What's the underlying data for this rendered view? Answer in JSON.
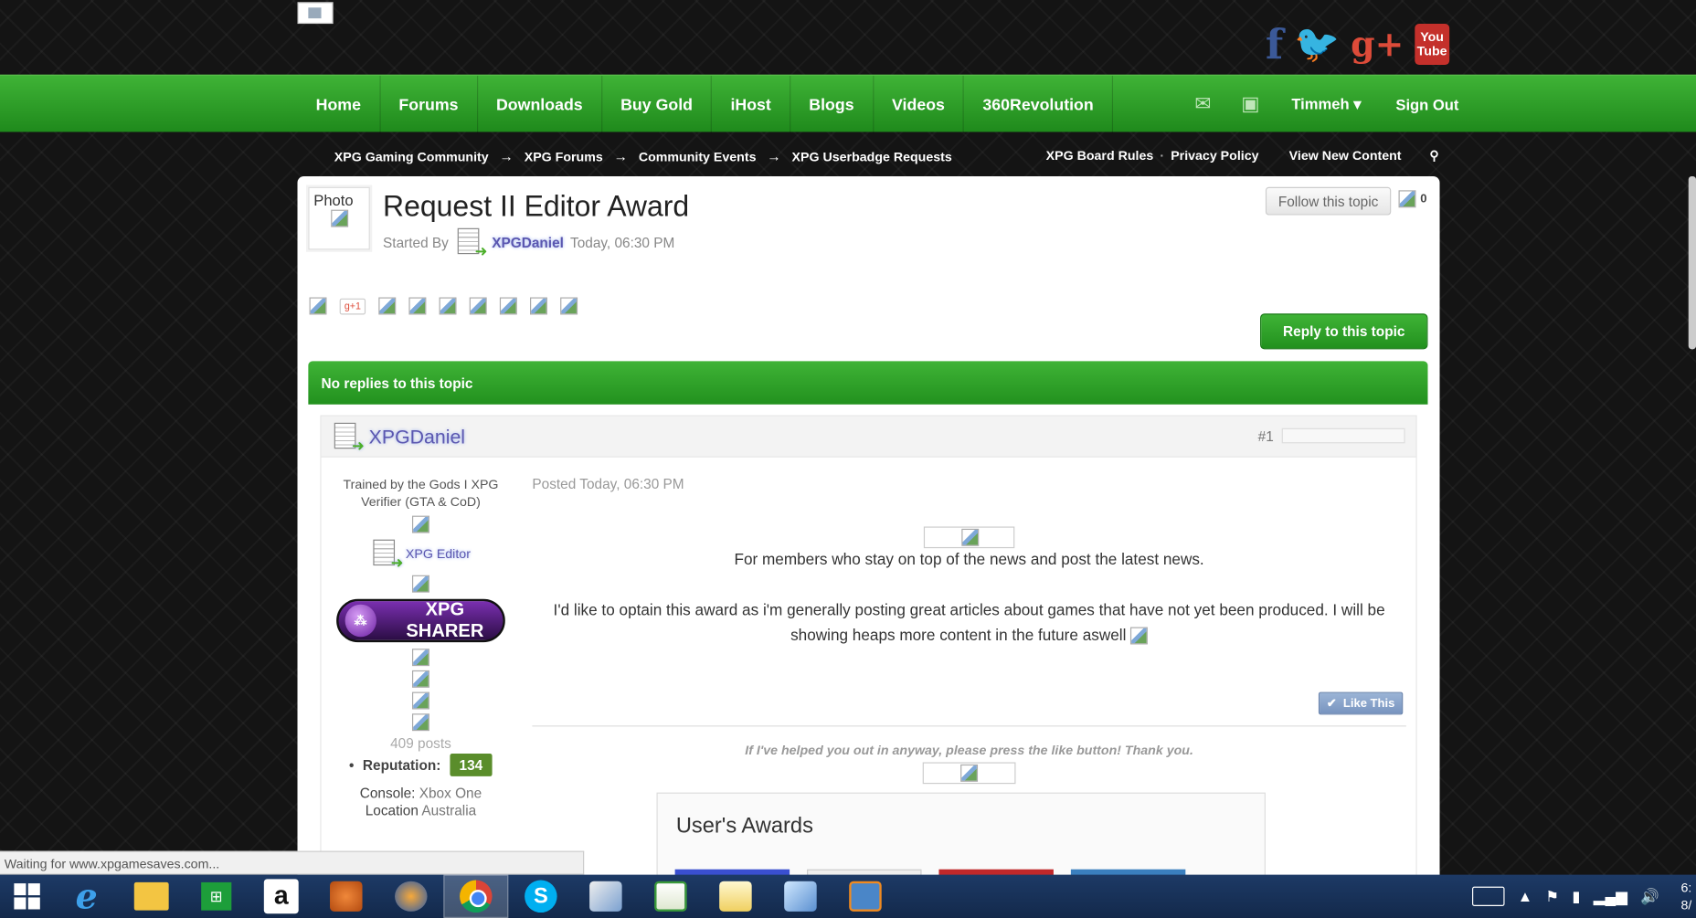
{
  "social": {
    "facebook": "f",
    "twitter": "🐦",
    "googleplus": "g+",
    "youtube_line1": "You",
    "youtube_line2": "Tube"
  },
  "nav": {
    "items": [
      "Home",
      "Forums",
      "Downloads",
      "Buy Gold",
      "iHost",
      "Blogs",
      "Videos",
      "360Revolution"
    ],
    "user": "Timmeh",
    "signout": "Sign Out"
  },
  "breadcrumb": {
    "items": [
      "XPG Gaming Community",
      "XPG Forums",
      "Community Events",
      "XPG Userbadge Requests"
    ],
    "arrow": "→"
  },
  "top_links": {
    "rules": "XPG Board Rules",
    "sep": "·",
    "privacy": "Privacy Policy",
    "new_content": "View New Content"
  },
  "topic": {
    "photo_label": "Photo",
    "title": "Request II Editor Award",
    "started_by": "Started By",
    "author": "XPGDaniel",
    "date": "Today, 06:30 PM",
    "follow_label": "Follow this topic",
    "follow_count": "0",
    "gplus": "g+1",
    "reply_label": "Reply to this topic",
    "replies_bar": "No replies to this topic"
  },
  "post": {
    "author": "XPGDaniel",
    "number": "#1",
    "member_title": "Trained by the Gods I XPG Verifier (GTA & CoD)",
    "group": "XPG Editor",
    "sharer_label": "XPG SHARER",
    "posts": "409 posts",
    "reputation_label": "Reputation:",
    "reputation": "134",
    "console_label": "Console:",
    "console": "Xbox One",
    "location_label": "Location",
    "location": "Australia",
    "posted": "Posted Today, 06:30 PM",
    "line1": "For members who stay on top of the news and post the latest news.",
    "line2": "I'd like to optain this award as i'm generally posting great articles about games that have not yet been produced. I will be showing heaps more content in the future aswell",
    "like_label": "Like This",
    "signature": "If I've helped you out in anyway, please press the like button! Thank you.",
    "awards_title": "User's Awards"
  },
  "status_bar": "Waiting for www.xpgamesaves.com...",
  "colors": {
    "accent_green": "#2ea028",
    "reputation_green": "#5a8d2b",
    "username_purple": "#5b57b0"
  }
}
